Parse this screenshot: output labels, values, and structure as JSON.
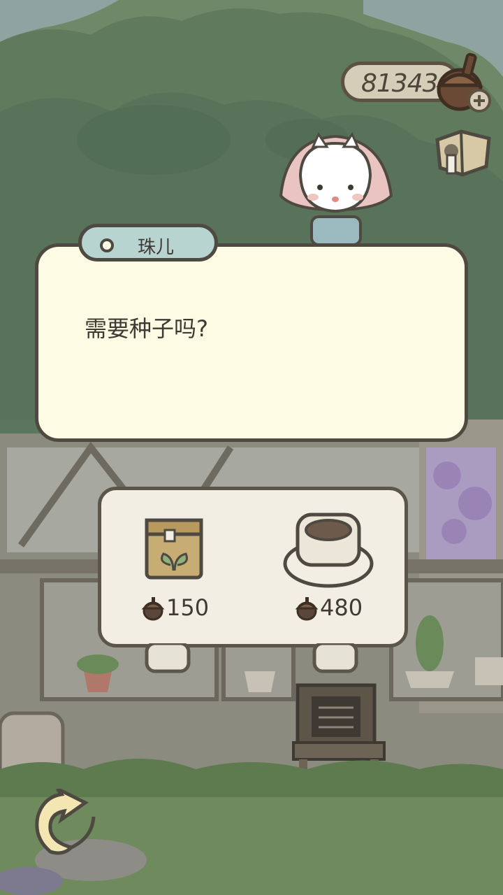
{
  "currency": {
    "amount": "81343",
    "icon": "acorn-icon",
    "add_icon": "plus-icon"
  },
  "map_button": {
    "icon": "map-icon"
  },
  "dialog": {
    "speaker": "珠儿",
    "text": "需要种子吗?"
  },
  "shop": {
    "items": [
      {
        "icon": "seed-bag-icon",
        "price": "150",
        "currency_icon": "acorn-icon"
      },
      {
        "icon": "flower-pot-icon",
        "price": "480",
        "currency_icon": "acorn-icon"
      }
    ]
  },
  "back_button": {
    "icon": "back-arrow-icon"
  },
  "colors": {
    "dialog_bg": "#fdfbe4",
    "name_tag_bg": "#b8d4d0",
    "outline": "#4e4a42"
  }
}
